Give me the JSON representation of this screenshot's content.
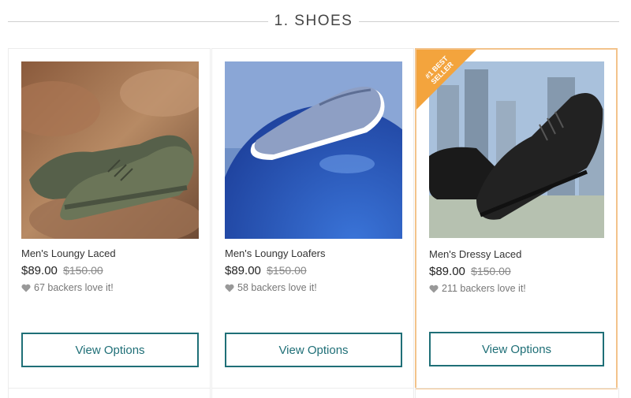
{
  "section": {
    "title": "1. SHOES"
  },
  "products": [
    {
      "name": "Men's Loungy Laced",
      "price": "$89.00",
      "old_price": "$150.00",
      "backers": "67 backers love it!",
      "button": "View Options"
    },
    {
      "name": "Men's Loungy Loafers",
      "price": "$89.00",
      "old_price": "$150.00",
      "backers": "58 backers love it!",
      "button": "View Options"
    },
    {
      "name": "Men's Dressy Laced",
      "price": "$89.00",
      "old_price": "$150.00",
      "backers": "211 backers love it!",
      "button": "View Options",
      "badge": "#1 BEST SELLER"
    }
  ],
  "colors": {
    "accent": "#1f6f77",
    "badge": "#f3a43d",
    "highlight_border": "#f3c38b"
  }
}
